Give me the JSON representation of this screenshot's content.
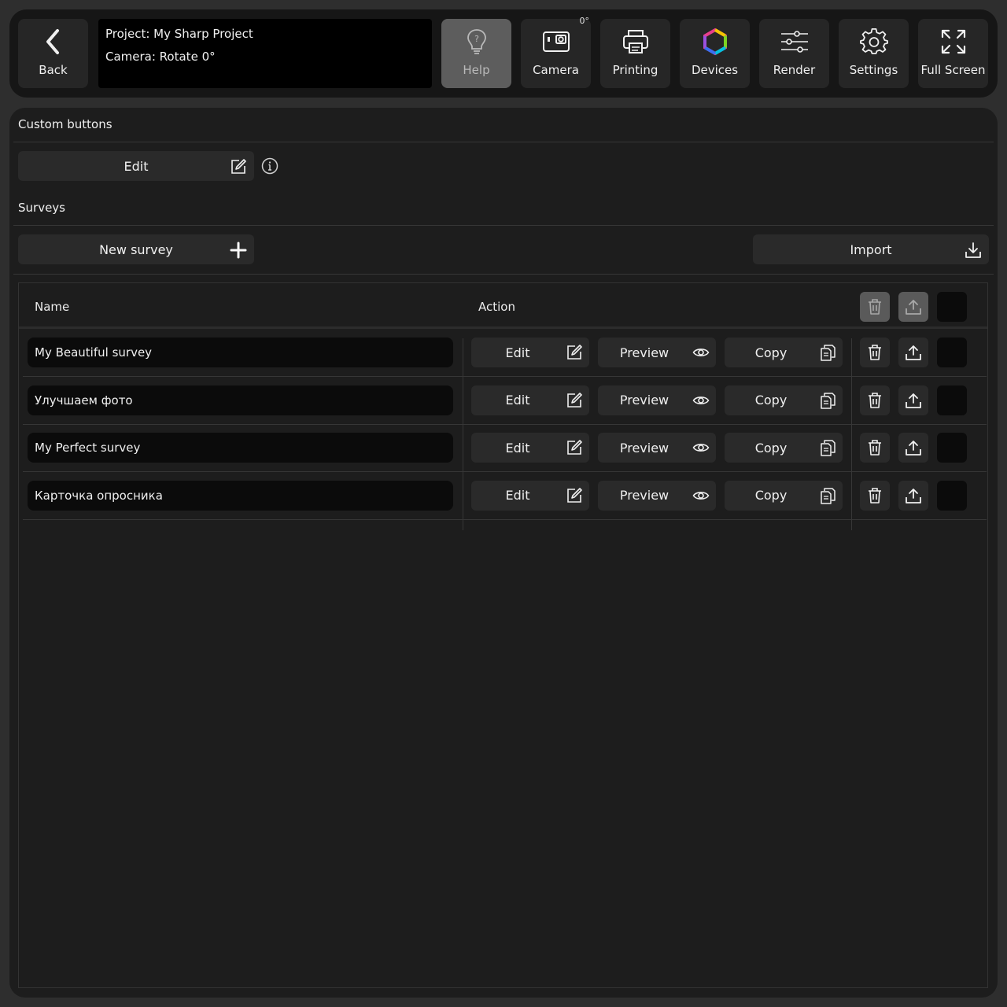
{
  "topbar": {
    "back_label": "Back",
    "project_line": "Project: My Sharp Project",
    "camera_line": "Camera: Rotate 0°",
    "help_label": "Help",
    "camera_label": "Camera",
    "camera_badge": "0°",
    "printing_label": "Printing",
    "devices_label": "Devices",
    "render_label": "Render",
    "settings_label": "Settings",
    "fullscreen_label": "Full Screen"
  },
  "custom_buttons": {
    "title": "Custom buttons",
    "edit_label": "Edit"
  },
  "surveys": {
    "title": "Surveys",
    "new_label": "New survey",
    "import_label": "Import",
    "columns": {
      "name": "Name",
      "action": "Action"
    },
    "rows": [
      {
        "name": "My Beautiful survey",
        "edit": "Edit",
        "preview": "Preview",
        "copy": "Copy"
      },
      {
        "name": "Улучшаем фото",
        "edit": "Edit",
        "preview": "Preview",
        "copy": "Copy"
      },
      {
        "name": "My Perfect survey",
        "edit": "Edit",
        "preview": "Preview",
        "copy": "Copy"
      },
      {
        "name": "Карточка опросника",
        "edit": "Edit",
        "preview": "Preview",
        "copy": "Copy"
      }
    ]
  },
  "icons": {
    "back": "chevron-left-icon",
    "help": "lightbulb-icon",
    "camera": "camera-icon",
    "printing": "printer-icon",
    "devices": "hexagon-ring-icon",
    "render": "sliders-icon",
    "settings": "gear-icon",
    "fullscreen": "expand-icon",
    "edit": "edit-icon",
    "info": "info-icon",
    "add": "plus-icon",
    "import": "download-icon",
    "preview": "eye-icon",
    "copy": "copy-icon",
    "delete": "trash-icon",
    "export": "upload-icon"
  },
  "colors": {
    "background": "#2e2e2e",
    "panel": "#1d1d1d",
    "button": "#2a2a2a",
    "active_button": "#5d5d5d",
    "field": "#0b0b0b",
    "text": "#f0f0f0"
  }
}
